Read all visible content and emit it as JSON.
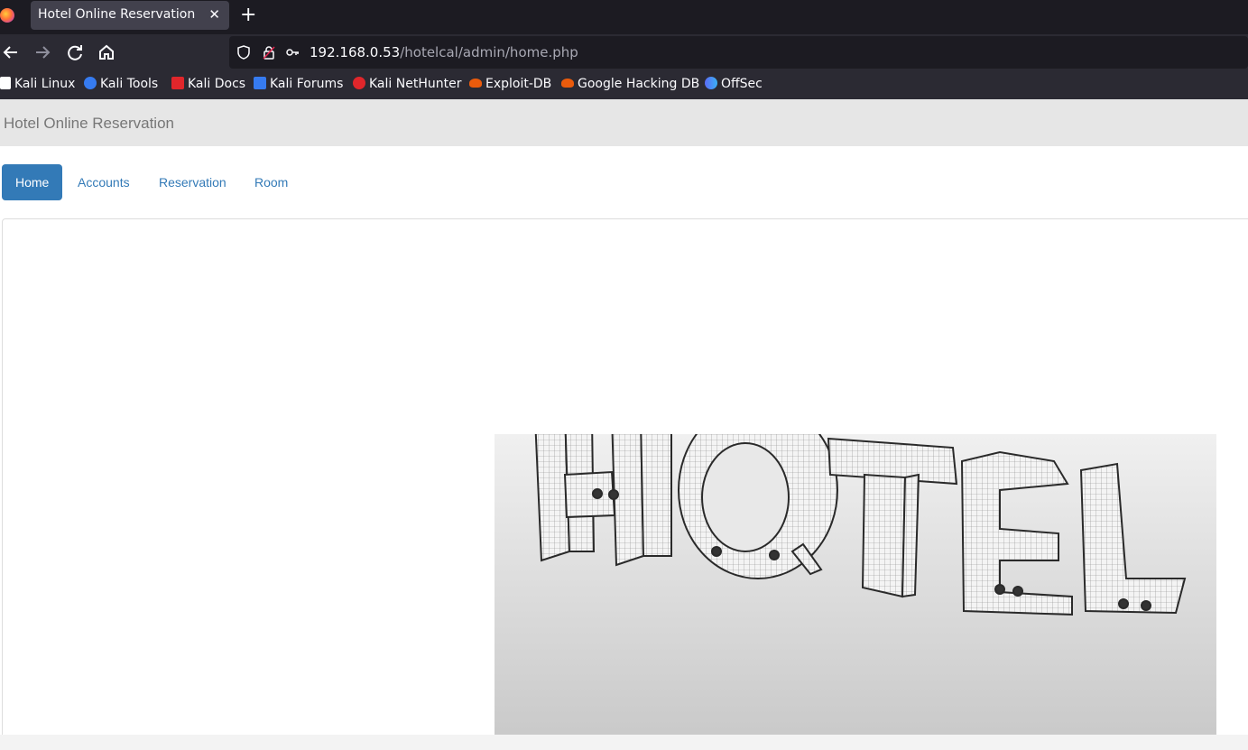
{
  "browser": {
    "tab_title": "Hotel Online Reservation",
    "tab_close": "✕",
    "new_tab": "+",
    "url_host": "192.168.0.53",
    "url_path": "/hotelcal/admin/home.php"
  },
  "bookmarks": [
    {
      "label": "Kali Linux",
      "icon": "kali-dragon-icon",
      "color": "#ffffff"
    },
    {
      "label": "Kali Tools",
      "icon": "kali-tools-icon",
      "color": "#367bf0"
    },
    {
      "label": "Kali Docs",
      "icon": "kali-docs-icon",
      "color": "#e0262b"
    },
    {
      "label": "Kali Forums",
      "icon": "kali-forums-icon",
      "color": "#367bf0"
    },
    {
      "label": "Kali NetHunter",
      "icon": "nethunter-icon",
      "color": "#e0262b"
    },
    {
      "label": "Exploit-DB",
      "icon": "exploitdb-icon",
      "color": "#ea5b0c"
    },
    {
      "label": "Google Hacking DB",
      "icon": "ghdb-icon",
      "color": "#ea5b0c"
    },
    {
      "label": "OffSec",
      "icon": "offsec-icon",
      "color": "#5b6bf5"
    }
  ],
  "site": {
    "brand": "Hotel Online Reservation"
  },
  "nav": [
    {
      "label": "Home",
      "active": true
    },
    {
      "label": "Accounts",
      "active": false
    },
    {
      "label": "Reservation",
      "active": false
    },
    {
      "label": "Room",
      "active": false
    }
  ],
  "hero": {
    "text": "HOTEL"
  },
  "colors": {
    "accent": "#337ab7",
    "header_bg": "#e6e6e6"
  }
}
